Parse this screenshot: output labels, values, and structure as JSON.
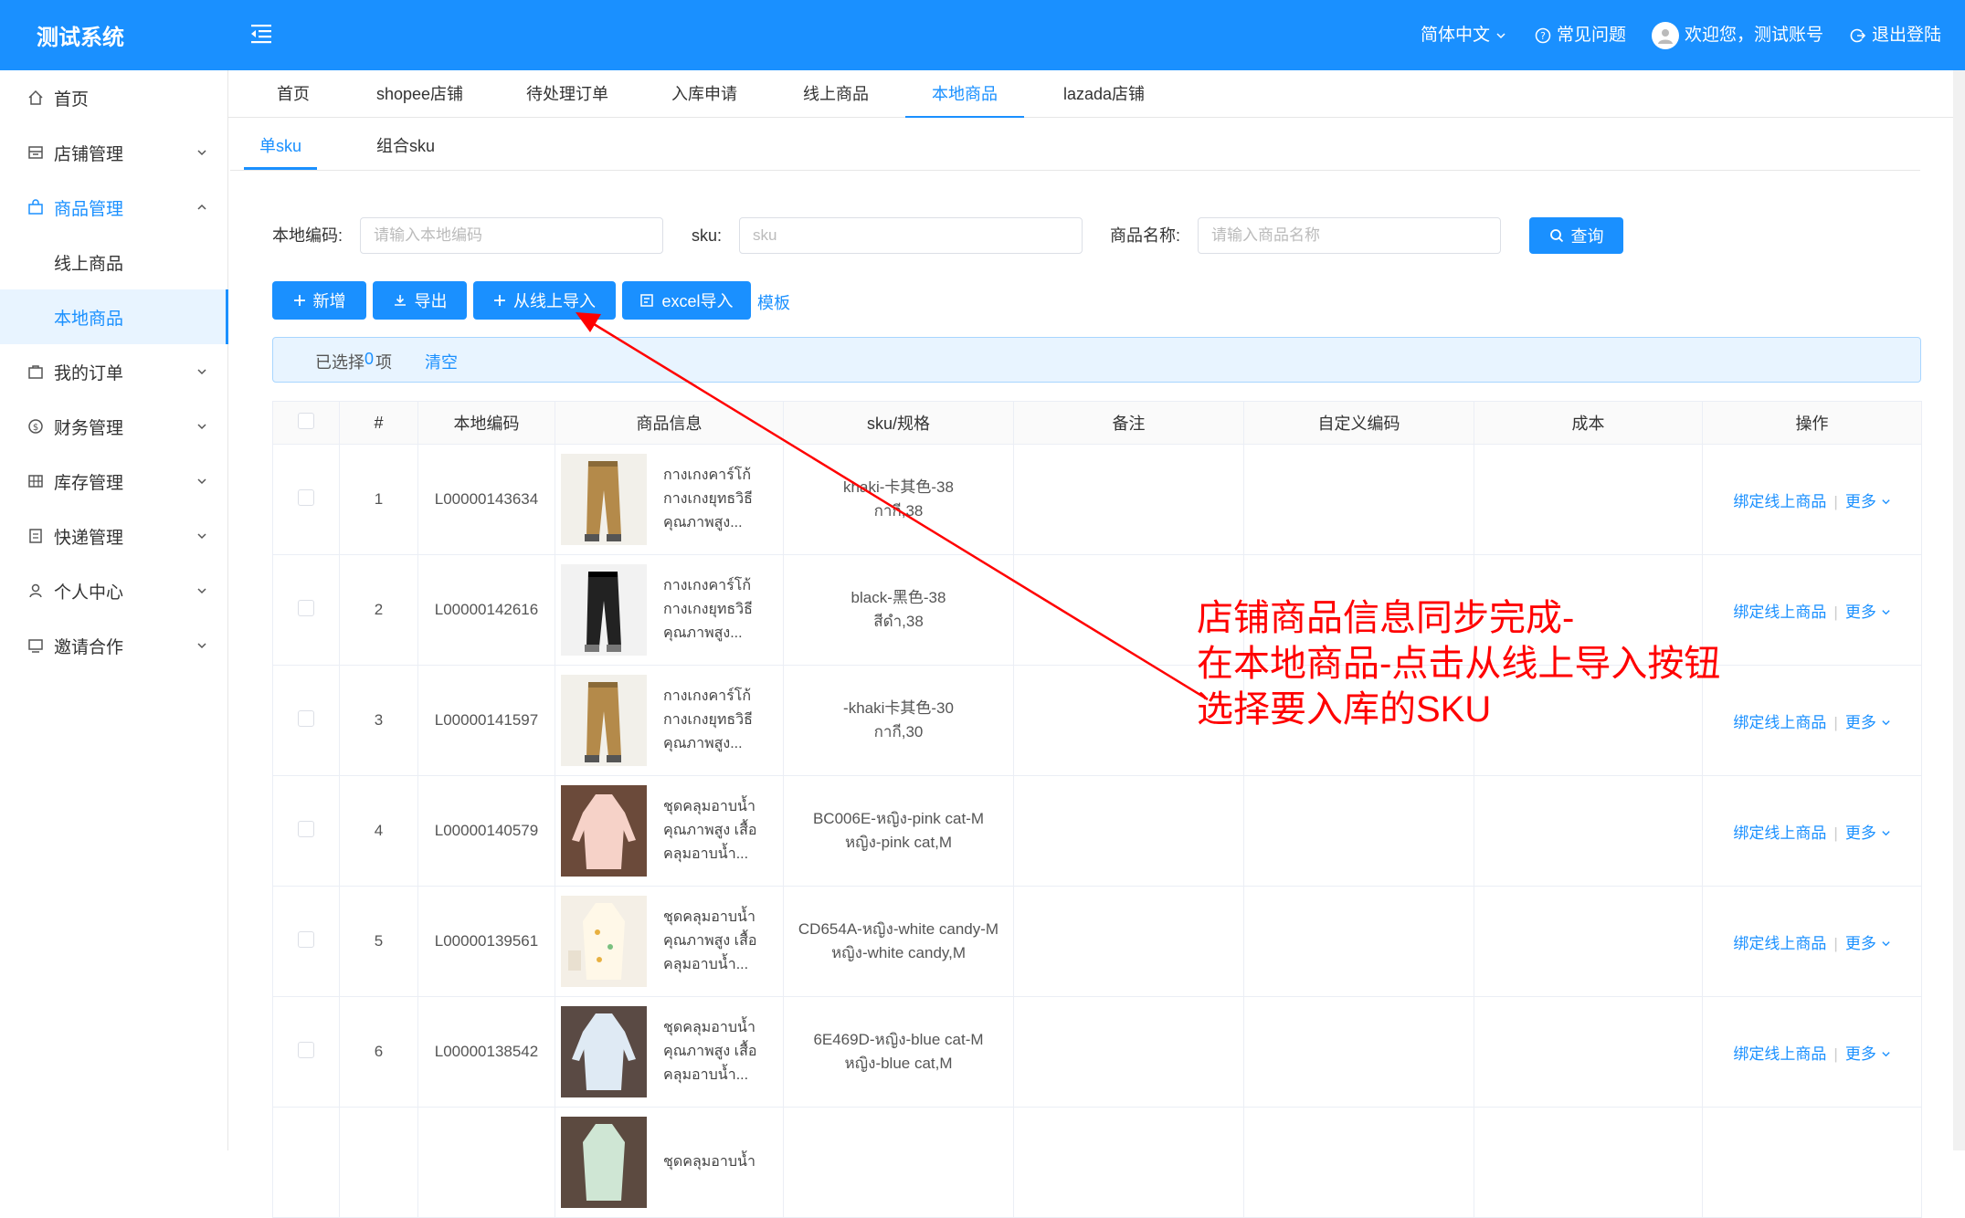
{
  "header": {
    "logo": "测试系统",
    "lang": "简体中文",
    "faq": "常见问题",
    "welcome": "欢迎您，测试账号",
    "logout": "退出登陆"
  },
  "sidebar": {
    "items": [
      {
        "label": "首页",
        "icon": "home-icon"
      },
      {
        "label": "店铺管理",
        "icon": "shop-icon"
      },
      {
        "label": "商品管理",
        "icon": "bag-icon"
      },
      {
        "label": "线上商品"
      },
      {
        "label": "本地商品"
      },
      {
        "label": "我的订单",
        "icon": "order-icon"
      },
      {
        "label": "财务管理",
        "icon": "finance-icon"
      },
      {
        "label": "库存管理",
        "icon": "grid-icon"
      },
      {
        "label": "快递管理",
        "icon": "express-icon"
      },
      {
        "label": "个人中心",
        "icon": "user-icon"
      },
      {
        "label": "邀请合作",
        "icon": "monitor-icon"
      }
    ]
  },
  "tabs": [
    "首页",
    "shopee店铺",
    "待处理订单",
    "入库申请",
    "线上商品",
    "本地商品",
    "lazada店铺"
  ],
  "subtabs": [
    "单sku",
    "组合sku"
  ],
  "filters": {
    "local_code_label": "本地编码:",
    "local_code_placeholder": "请输入本地编码",
    "sku_label": "sku:",
    "sku_placeholder": "sku",
    "name_label": "商品名称:",
    "name_placeholder": "请输入商品名称",
    "search_btn": "查询"
  },
  "toolbar": {
    "add": "新增",
    "export": "导出",
    "import_online": "从线上导入",
    "excel_import": "excel导入",
    "template": "模板"
  },
  "selection": {
    "prefix": "已选择",
    "count": "0",
    "suffix": "项",
    "clear": "清空"
  },
  "table": {
    "headers": [
      "#",
      "本地编码",
      "商品信息",
      "sku/规格",
      "备注",
      "自定义编码",
      "成本",
      "操作"
    ],
    "bind_label": "绑定线上商品",
    "more_label": "更多",
    "rows": [
      {
        "no": "1",
        "code": "L00000143634",
        "name": "กางเกงคาร์โก้ กางเกงยุทธวิธี คุณภาพสูง...",
        "sku1": "khaki-卡其色-38",
        "sku2": "กากี,38",
        "img": "pants-khaki"
      },
      {
        "no": "2",
        "code": "L00000142616",
        "name": "กางเกงคาร์โก้ กางเกงยุทธวิธี คุณภาพสูง...",
        "sku1": "black-黑色-38",
        "sku2": "สีดำ,38",
        "img": "pants-black"
      },
      {
        "no": "3",
        "code": "L00000141597",
        "name": "กางเกงคาร์โก้ กางเกงยุทธวิธี คุณภาพสูง...",
        "sku1": "-khaki卡其色-30",
        "sku2": "กากี,30",
        "img": "pants-khaki"
      },
      {
        "no": "4",
        "code": "L00000140579",
        "name": "ชุดคลุมอาบน้ำ คุณภาพสูง เสื้อ คลุมอาบน้ำ...",
        "sku1": "BC006E-หญิง-pink cat-M",
        "sku2": "หญิง-pink cat,M",
        "img": "robe-pink"
      },
      {
        "no": "5",
        "code": "L00000139561",
        "name": "ชุดคลุมอาบน้ำ คุณภาพสูง เสื้อ คลุมอาบน้ำ...",
        "sku1": "CD654A-หญิง-white candy-M",
        "sku2": "หญิง-white candy,M",
        "img": "robe-white"
      },
      {
        "no": "6",
        "code": "L00000138542",
        "name": "ชุดคลุมอาบน้ำ คุณภาพสูง เสื้อ คลุมอาบน้ำ...",
        "sku1": "6E469D-หญิง-blue cat-M",
        "sku2": "หญิง-blue cat,M",
        "img": "robe-blue"
      },
      {
        "no": "",
        "code": "",
        "name": "ชุดคลุมอาบน้ำ",
        "sku1": "",
        "sku2": "",
        "img": "robe-green"
      }
    ]
  },
  "annotation": {
    "line1": "店铺商品信息同步完成-",
    "line2": "在本地商品-点击从线上导入按钮",
    "line3": "选择要入库的SKU",
    "color": "#ff0000"
  },
  "colors": {
    "primary": "#1a90ff",
    "annotation": "#ff0000"
  }
}
